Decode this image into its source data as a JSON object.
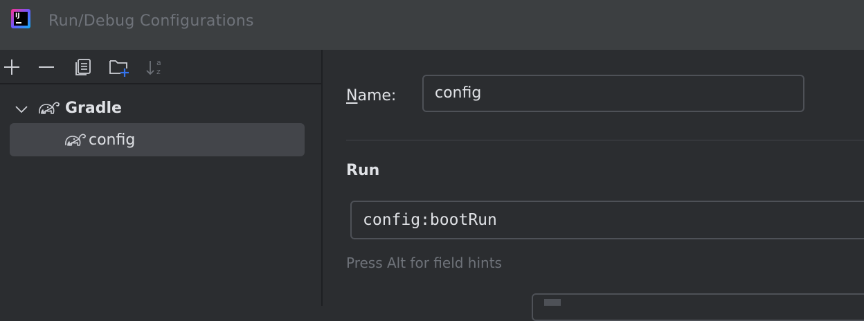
{
  "window": {
    "title": "Run/Debug Configurations",
    "logo_text": "IJ"
  },
  "toolbar": {
    "buttons": [
      {
        "name": "add",
        "icon": "plus-icon"
      },
      {
        "name": "remove",
        "icon": "minus-icon"
      },
      {
        "name": "copy",
        "icon": "copy-icon"
      },
      {
        "name": "new-folder",
        "icon": "folder-add-icon"
      },
      {
        "name": "sort",
        "icon": "sort-alpha-icon"
      }
    ],
    "sort_glyph_top": "a",
    "sort_glyph_bottom": "z"
  },
  "tree": {
    "group": {
      "label": "Gradle",
      "icon": "gradle-elephant-icon",
      "expanded": true
    },
    "items": [
      {
        "label": "config",
        "icon": "gradle-elephant-icon",
        "selected": true
      }
    ]
  },
  "form": {
    "name_label_mnemonic": "N",
    "name_label_rest": "ame:",
    "name_value": "config",
    "section_run": "Run",
    "run_value": "config:bootRun",
    "hint": "Press Alt for field hints"
  },
  "colors": {
    "background": "#2b2d30",
    "titlebar": "#3c3f41",
    "selection": "#43454a",
    "border": "#4e5157",
    "text": "#dfe1e5",
    "muted_text": "#6f737a",
    "accent_blue": "#3574f0"
  }
}
